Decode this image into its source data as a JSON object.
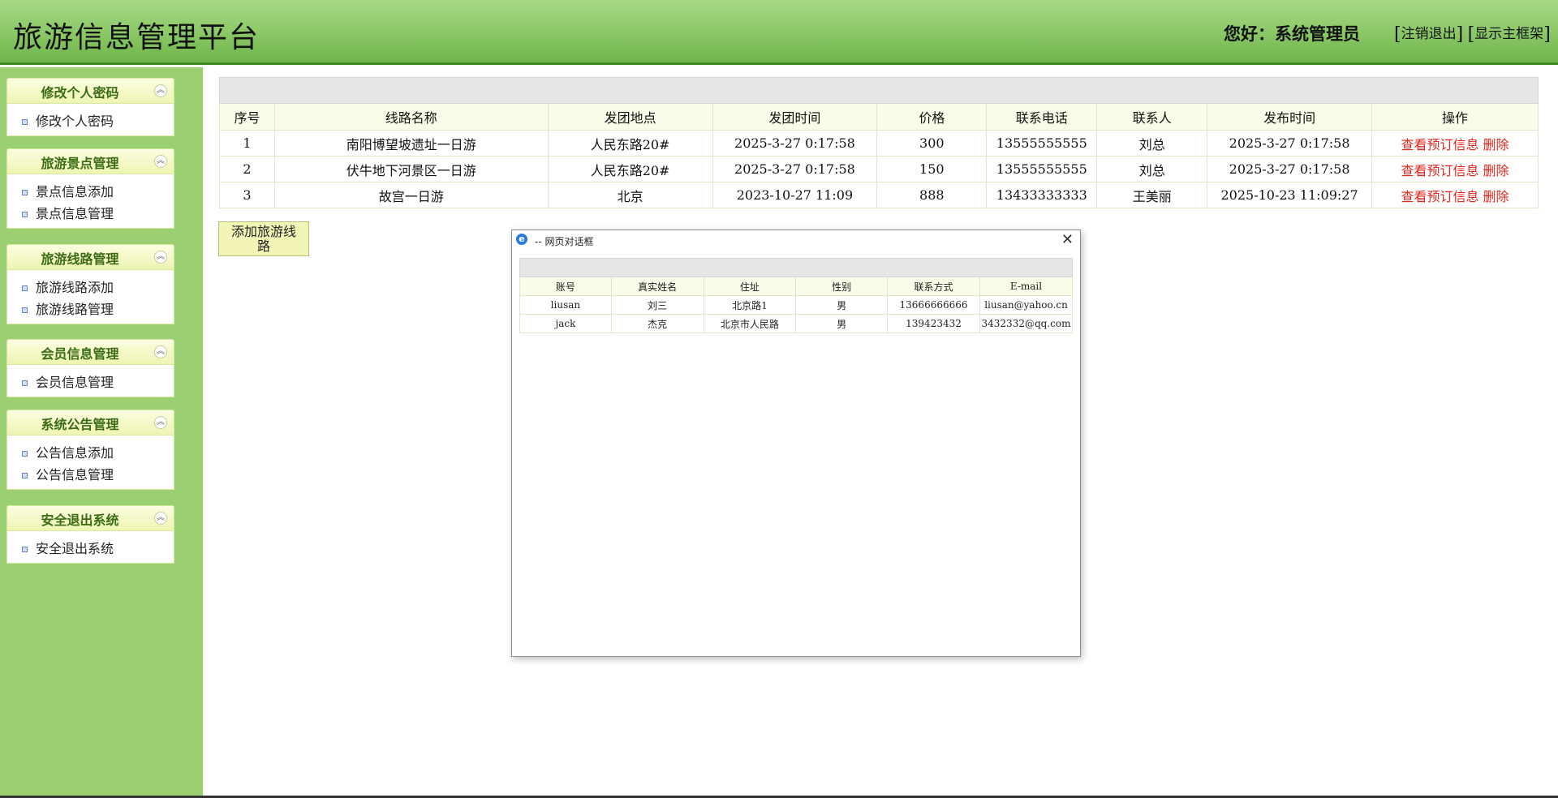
{
  "header": {
    "title": "旅游信息管理平台",
    "greeting": "您好：系统管理员",
    "logout": "注销退出",
    "show_frame": "显示主框架"
  },
  "sidebar": {
    "panels": [
      {
        "title": "修改个人密码",
        "items": [
          "修改个人密码"
        ]
      },
      {
        "title": "旅游景点管理",
        "items": [
          "景点信息添加",
          "景点信息管理"
        ]
      },
      {
        "title": "旅游线路管理",
        "items": [
          "旅游线路添加",
          "旅游线路管理"
        ]
      },
      {
        "title": "会员信息管理",
        "items": [
          "会员信息管理"
        ]
      },
      {
        "title": "系统公告管理",
        "items": [
          "公告信息添加",
          "公告信息管理"
        ]
      },
      {
        "title": "安全退出系统",
        "items": [
          "安全退出系统"
        ]
      }
    ],
    "toggle_icon": "collapse-up-icon"
  },
  "routes_table": {
    "headers": [
      "序号",
      "线路名称",
      "发团地点",
      "发团时间",
      "价格",
      "联系电话",
      "联系人",
      "发布时间",
      "操作"
    ],
    "rows": [
      {
        "no": "1",
        "name": "南阳博望坡遗址一日游",
        "place": "人民东路20#",
        "depart": "2025-3-27 0:17:58",
        "price": "300",
        "phone": "13555555555",
        "contact": "刘总",
        "published": "2025-3-27 0:17:58"
      },
      {
        "no": "2",
        "name": "伏牛地下河景区一日游",
        "place": "人民东路20#",
        "depart": "2025-3-27 0:17:58",
        "price": "150",
        "phone": "13555555555",
        "contact": "刘总",
        "published": "2025-3-27 0:17:58"
      },
      {
        "no": "3",
        "name": "故宫一日游",
        "place": "北京",
        "depart": "2023-10-27 11:09",
        "price": "888",
        "phone": "13433333333",
        "contact": "王美丽",
        "published": "2025-10-23 11:09:27"
      }
    ],
    "op_view": "查看预订信息",
    "op_delete": "删除",
    "op_color": "#e0281e"
  },
  "add_button": {
    "line1": "添加旅游线",
    "line2": "路"
  },
  "dialog": {
    "title": "-- 网页对话框",
    "headers": [
      "账号",
      "真实姓名",
      "住址",
      "性别",
      "联系方式",
      "E-mail"
    ],
    "rows": [
      [
        "liusan",
        "刘三",
        "北京路1",
        "男",
        "13666666666",
        "liusan@yahoo.cn"
      ],
      [
        "jack",
        "杰克",
        "北京市人民路",
        "男",
        "139423432",
        "3432332@qq.com"
      ]
    ]
  },
  "colors": {
    "header_green": "#8fcb6b",
    "sidebar_green": "#9acf72",
    "panel_header": "#eef5b3",
    "panel_title_text": "#3b6b14",
    "add_button_bg": "#f2f5b6"
  }
}
